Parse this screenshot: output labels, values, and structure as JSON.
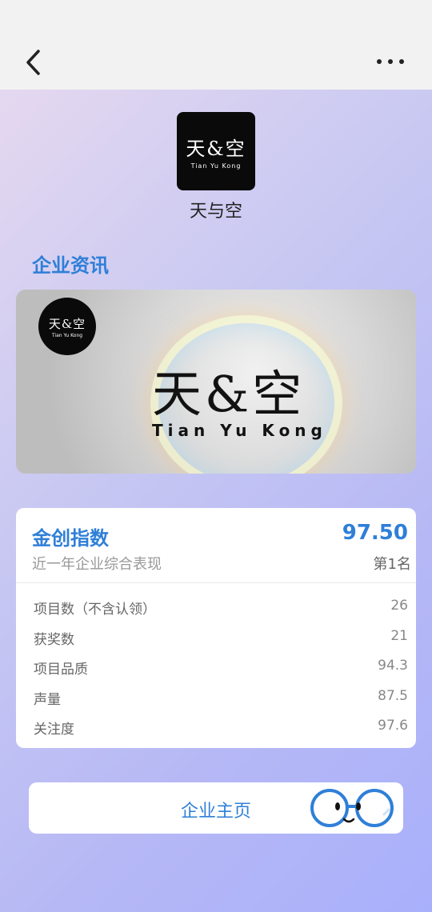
{
  "header": {
    "back_icon": "chevron-left-icon",
    "more_icon": "more-dots-icon"
  },
  "company": {
    "logo_text_cn": "天&空",
    "logo_text_en": "Tian Yu Kong",
    "name": "天与空"
  },
  "news": {
    "section_title": "企业资讯",
    "banner_badge_cn": "天&空",
    "banner_badge_en": "Tian Yu Kong",
    "banner_cn": "天&空",
    "banner_en": "Tian Yu Kong"
  },
  "index_card": {
    "title": "金创指数",
    "score": "97.50",
    "subtitle": "近一年企业综合表现",
    "rank": "第1名",
    "rows": [
      {
        "label": "项目数（不含认领）",
        "value": "26"
      },
      {
        "label": "获奖数",
        "value": "21"
      },
      {
        "label": "项目品质",
        "value": "94.3"
      },
      {
        "label": "声量",
        "value": "87.5"
      },
      {
        "label": "关注度",
        "value": "97.6"
      }
    ]
  },
  "home_button": {
    "label": "企业主页",
    "mascot_icon": "glasses-mascot-icon"
  },
  "colors": {
    "accent": "#2f7fd8",
    "card_bg": "#ffffff"
  }
}
